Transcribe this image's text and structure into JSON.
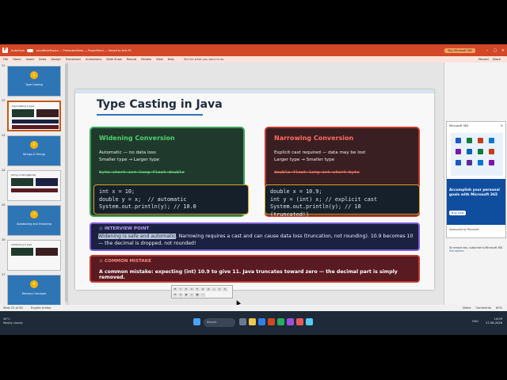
{
  "app": {
    "logo_letter": "P",
    "autosave": "AutoSave",
    "filename": "JavaBibleTopics — ProtectedView — PowerPoint — Saved to this PC",
    "buy_button": "Buy Microsoft 365"
  },
  "menu": {
    "items": [
      "File",
      "Home",
      "Insert",
      "Draw",
      "Design",
      "Transitions",
      "Animations",
      "Slide Show",
      "Record",
      "Review",
      "View",
      "Help"
    ],
    "tell_me": "Tell me what you want to do",
    "right_items": [
      "Record",
      "Share"
    ]
  },
  "thumbnails": [
    {
      "num": "21",
      "kind": "section",
      "circle": "5",
      "label": "Type Casting"
    },
    {
      "num": "22",
      "kind": "slide",
      "label": "Type Casting in Java",
      "selected": true
    },
    {
      "num": "23",
      "kind": "section",
      "circle": "6",
      "label": "Strings & Strings"
    },
    {
      "num": "24",
      "kind": "slide",
      "label": "String vs StringBuilder"
    },
    {
      "num": "25",
      "kind": "section",
      "circle": "7",
      "label": "Autoboxing and Unboxing"
    },
    {
      "num": "26",
      "kind": "slide",
      "label": "Autoboxing in Java"
    },
    {
      "num": "27",
      "kind": "section",
      "circle": "8",
      "label": "Memory Concepts"
    }
  ],
  "slide": {
    "title": "Type Casting in Java",
    "widening": {
      "heading": "Widening Conversion",
      "line1": "Automatic — no data loss",
      "line2": "Smaller type → Larger type",
      "sequence": "byte→short→int→long→float→double",
      "code": "int x = 10;\ndouble y = x;  // automatic\nSystem.out.println(y); // 10.0"
    },
    "narrowing": {
      "heading": "Narrowing Conversion",
      "line1": "Explicit cast required — data may be lost",
      "line2": "Larger type → Smaller type",
      "sequence": "double→float→long→int→short→byte",
      "code": "double x = 10.9;\nint y = (int) x; // explicit cast\nSystem.out.println(y); // 10\n(truncated!)"
    },
    "interview": {
      "heading": "INTERVIEW POINT",
      "highlighted": "Widening is safe and automatic",
      "text": ". Narrowing requires a cast and can cause data loss (truncation, not rounding). 10.9 becomes 10 — the decimal is dropped, not rounded!"
    },
    "mistake": {
      "heading": "COMMON MISTAKE",
      "text": "A common mistake: expecting (int) 10.9 to give 11. Java truncates toward zero — the decimal part is simply removed."
    }
  },
  "ad": {
    "header": "Microsoft 365",
    "close": "×",
    "message": "Accomplish your personal goals with Microsoft 365",
    "cta": "Buy now",
    "sponsor": "Sponsored by Microsoft",
    "note": "To remove ads, subscribe to Microsoft 365.",
    "note_link": "See options"
  },
  "status": {
    "slide_info": "Slide 22 of 40",
    "language": "English (India)",
    "right": [
      "Notes",
      "Comments",
      "60%"
    ]
  },
  "taskbar": {
    "weather_temp": "34°C",
    "weather_desc": "Mostly cloudy",
    "search": "Search",
    "time": "14:09",
    "date": "27-06-2026",
    "lang": "ENG"
  },
  "colors": {
    "accent": "#d24726",
    "widening": "#3ea05a",
    "narrowing": "#c0392b",
    "interview": "#7d5bd6"
  }
}
